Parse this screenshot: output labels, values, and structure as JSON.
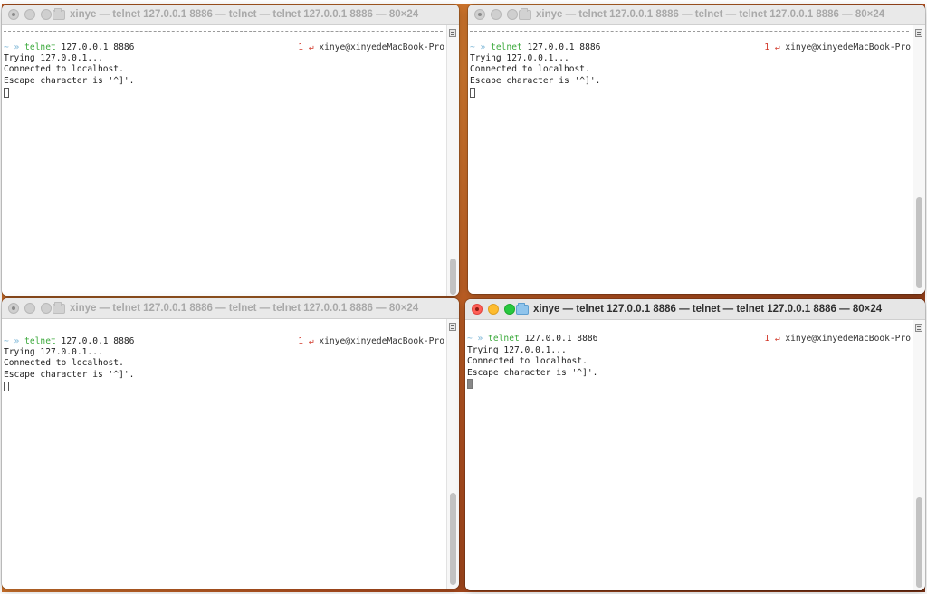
{
  "windows": [
    {
      "id": "top-left",
      "title": "xinye — telnet 127.0.0.1 8886 — telnet — telnet 127.0.0.1 8886 — 80×24",
      "active": false,
      "prompt_arrow": "~ »",
      "command": "telnet",
      "args": "127.0.0.1 8886",
      "return_code": "1",
      "return_icon": "↵",
      "user_host": "xinye@xinyedeMacBook-Pro",
      "output": [
        "Trying 127.0.0.1...",
        "Connected to localhost.",
        "Escape character is '^]'."
      ]
    },
    {
      "id": "top-right",
      "title": "xinye — telnet 127.0.0.1 8886 — telnet — telnet 127.0.0.1 8886 — 80×24",
      "active": false,
      "prompt_arrow": "~ »",
      "command": "telnet",
      "args": "127.0.0.1 8886",
      "return_code": "1",
      "return_icon": "↵",
      "user_host": "xinye@xinyedeMacBook-Pro",
      "output": [
        "Trying 127.0.0.1...",
        "Connected to localhost.",
        "Escape character is '^]'."
      ]
    },
    {
      "id": "bottom-left",
      "title": "xinye — telnet 127.0.0.1 8886 — telnet — telnet 127.0.0.1 8886 — 80×24",
      "active": false,
      "prompt_arrow": "~ »",
      "command": "telnet",
      "args": "127.0.0.1 8886",
      "return_code": "1",
      "return_icon": "↵",
      "user_host": "xinye@xinyedeMacBook-Pro",
      "output": [
        "Trying 127.0.0.1...",
        "Connected to localhost.",
        "Escape character is '^]'."
      ]
    },
    {
      "id": "bottom-right",
      "title": "xinye — telnet 127.0.0.1 8886 — telnet — telnet 127.0.0.1 8886 — 80×24",
      "active": true,
      "prompt_arrow": "~ »",
      "command": "telnet",
      "args": "127.0.0.1 8886",
      "return_code": "1",
      "return_icon": "↵",
      "user_host": "xinye@xinyedeMacBook-Pro",
      "output": [
        "Trying 127.0.0.1...",
        "Connected to localhost.",
        "Escape character is '^]'."
      ]
    }
  ],
  "colors": {
    "close_light": "#ff5f57",
    "minimize_light": "#febc2e",
    "zoom_light": "#28c840",
    "prompt_command": "#3daa3d",
    "return_code": "#d2392b"
  }
}
